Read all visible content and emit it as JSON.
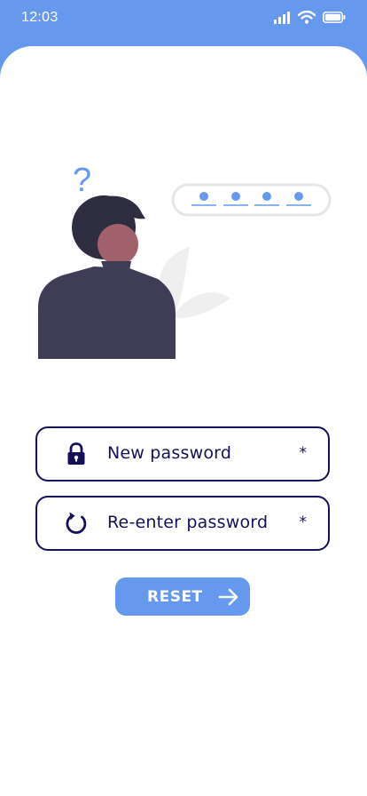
{
  "status_bar": {
    "time": "12:03",
    "icons": [
      "signal-icon",
      "wifi-icon",
      "battery-icon"
    ]
  },
  "illustration": {
    "question_mark": "?",
    "password_dots": 4
  },
  "form": {
    "new_password": {
      "label": "New password",
      "required_mark": "*",
      "icon": "lock-icon"
    },
    "confirm_password": {
      "label": "Re-enter password",
      "required_mark": "*",
      "icon": "refresh-icon"
    },
    "reset_button": {
      "label": "RESET",
      "icon": "arrow-right-icon"
    }
  },
  "colors": {
    "accent": "#6699ee",
    "navy": "#14105a",
    "background": "#ffffff",
    "figure_body": "#3f3d56",
    "hair": "#2f2e41",
    "skin": "#a0616a"
  }
}
